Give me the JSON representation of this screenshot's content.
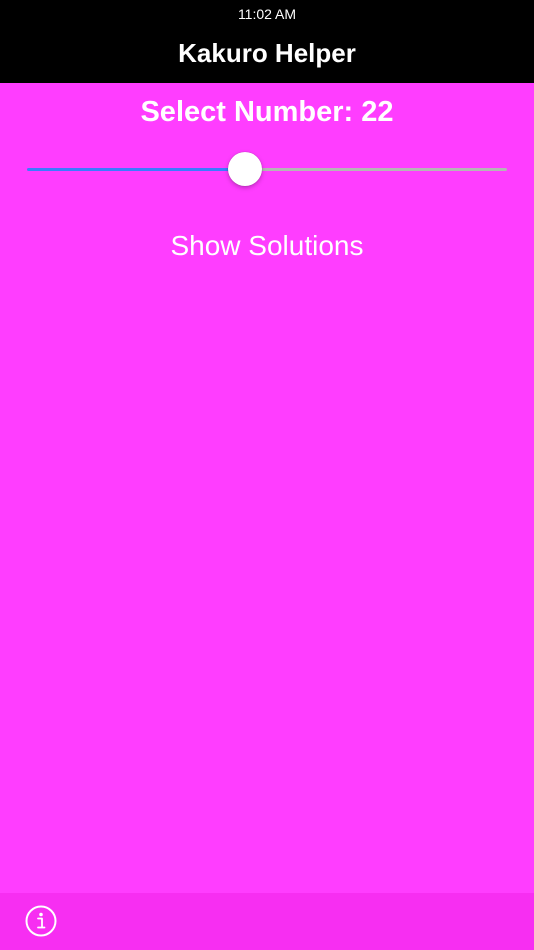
{
  "status_bar": {
    "time": "11:02 AM"
  },
  "nav": {
    "title": "Kakuro Helper"
  },
  "main": {
    "select_label": "Select Number: 22",
    "slider": {
      "value": 22,
      "fraction": 0.455
    },
    "show_solutions_label": "Show Solutions"
  },
  "toolbar": {
    "info_icon": "info-circle"
  },
  "colors": {
    "background": "#ff3dff",
    "toolbar": "#f72ef2",
    "nav": "#000000",
    "slider_min_track": "#3b7bff",
    "slider_max_track": "#b5b5b5",
    "text": "#ffffff"
  }
}
